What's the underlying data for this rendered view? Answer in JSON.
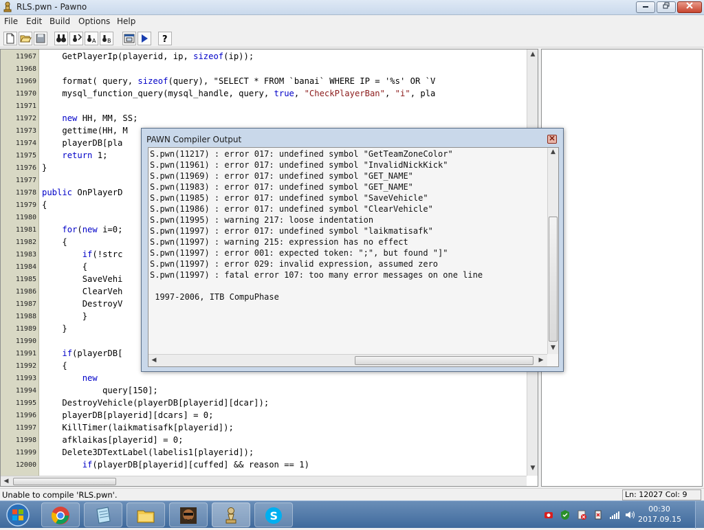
{
  "window": {
    "title": "RLS.pwn - Pawno"
  },
  "menu": [
    "File",
    "Edit",
    "Build",
    "Options",
    "Help"
  ],
  "editor": {
    "lines": [
      {
        "n": "11967",
        "text": "    GetPlayerIp(playerid, ip, sizeof(ip));"
      },
      {
        "n": "11968",
        "text": ""
      },
      {
        "n": "11969",
        "text": "    format( query, sizeof(query), \"SELECT * FROM `banai` WHERE IP = '%s' OR `V"
      },
      {
        "n": "11970",
        "text": "    mysql_function_query(mysql_handle, query, true, \"CheckPlayerBan\", \"i\", pla"
      },
      {
        "n": "11971",
        "text": ""
      },
      {
        "n": "11972",
        "text": "    new HH, MM, SS;"
      },
      {
        "n": "11973",
        "text": "    gettime(HH, M"
      },
      {
        "n": "11974",
        "text": "    playerDB[pla"
      },
      {
        "n": "11975",
        "text": "    return 1;"
      },
      {
        "n": "11976",
        "text": "}"
      },
      {
        "n": "11977",
        "text": ""
      },
      {
        "n": "11978",
        "text": "public OnPlayerD"
      },
      {
        "n": "11979",
        "text": "{"
      },
      {
        "n": "11980",
        "text": ""
      },
      {
        "n": "11981",
        "text": "    for(new i=0;"
      },
      {
        "n": "11982",
        "text": "    {"
      },
      {
        "n": "11983",
        "text": "        if(!strc"
      },
      {
        "n": "11984",
        "text": "        {"
      },
      {
        "n": "11985",
        "text": "        SaveVehi"
      },
      {
        "n": "11986",
        "text": "        ClearVeh"
      },
      {
        "n": "11987",
        "text": "        DestroyV"
      },
      {
        "n": "11988",
        "text": "        }"
      },
      {
        "n": "11989",
        "text": "    }"
      },
      {
        "n": "11990",
        "text": ""
      },
      {
        "n": "11991",
        "text": "    if(playerDB["
      },
      {
        "n": "11992",
        "text": "    {"
      },
      {
        "n": "11993",
        "text": "        new"
      },
      {
        "n": "11994",
        "text": "            query[150];"
      },
      {
        "n": "11995",
        "text": "    DestroyVehicle(playerDB[playerid][dcar]);"
      },
      {
        "n": "11996",
        "text": "    playerDB[playerid][dcars] = 0;"
      },
      {
        "n": "11997",
        "text": "    KillTimer(laikmatisafk[playerid]);"
      },
      {
        "n": "11998",
        "text": "    afklaikas[playerid] = 0;"
      },
      {
        "n": "11999",
        "text": "    Delete3DTextLabel(labelis1[playerid]);"
      },
      {
        "n": "12000",
        "text": "        if(playerDB[playerid][cuffed] && reason == 1)"
      }
    ]
  },
  "dialog": {
    "title": "PAWN Compiler Output",
    "lines": [
      "S.pwn(11217) : error 017: undefined symbol \"GetTeamZoneColor\"",
      "S.pwn(11961) : error 017: undefined symbol \"InvalidNickKick\"",
      "S.pwn(11969) : error 017: undefined symbol \"GET_NAME\"",
      "S.pwn(11983) : error 017: undefined symbol \"GET_NAME\"",
      "S.pwn(11985) : error 017: undefined symbol \"SaveVehicle\"",
      "S.pwn(11986) : error 017: undefined symbol \"ClearVehicle\"",
      "S.pwn(11995) : warning 217: loose indentation",
      "S.pwn(11997) : error 017: undefined symbol \"laikmatisafk\"",
      "S.pwn(11997) : warning 215: expression has no effect",
      "S.pwn(11997) : error 001: expected token: \";\", but found \"]\"",
      "S.pwn(11997) : error 029: invalid expression, assumed zero",
      "S.pwn(11997) : fatal error 107: too many error messages on one line",
      "",
      " 1997-2006, ITB CompuPhase"
    ]
  },
  "status": {
    "message": "Unable to compile 'RLS.pwn'.",
    "position": "Ln: 12027  Col: 9"
  },
  "taskbar": {
    "clock_time": "00:30",
    "clock_date": "2017.09.15"
  },
  "colors": {
    "keyword": "#0000c8",
    "string": "#8b1a1a",
    "gutter": "#d8d8c4",
    "dialog_frame": "#c9d8ea",
    "taskbar": "#3f6a9c"
  }
}
